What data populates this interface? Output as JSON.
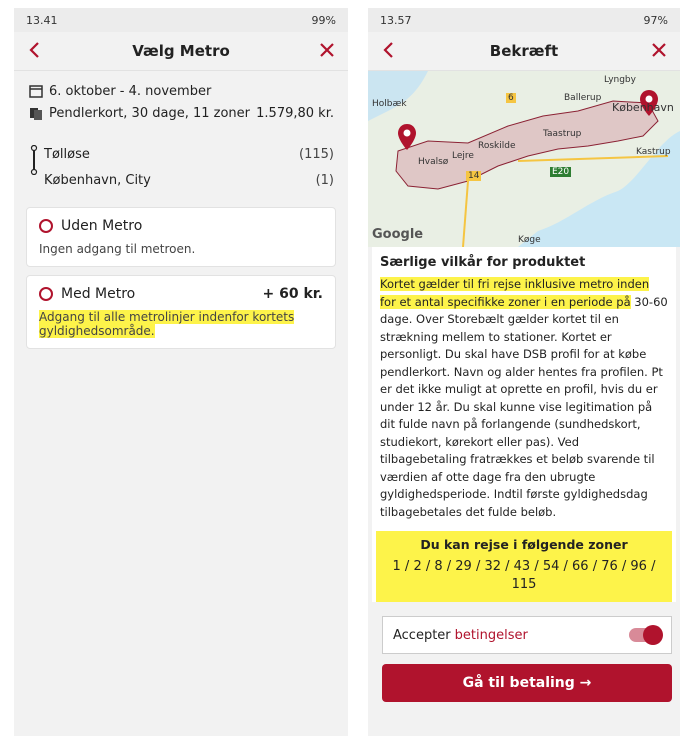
{
  "left": {
    "status": {
      "time": "13.41",
      "battery": "99%"
    },
    "title": "Vælg Metro",
    "trip": {
      "dates": "6. oktober - 4. november",
      "ticket": "Pendlerkort, 30 dage, 11 zoner",
      "price": "1.579,80 kr."
    },
    "stops": [
      {
        "name": "Tølløse",
        "zone": "(115)"
      },
      {
        "name": "København, City",
        "zone": "(1)"
      }
    ],
    "options": [
      {
        "title": "Uden Metro",
        "addon": "",
        "desc": "Ingen adgang til metroen."
      },
      {
        "title": "Med Metro",
        "addon": "+ 60 kr.",
        "desc": "Adgang til alle metrolinjer indenfor kortets gyldighedsområde."
      }
    ]
  },
  "right": {
    "status": {
      "time": "13.57",
      "battery": "97%"
    },
    "title": "Bekræft",
    "map": {
      "labels": [
        "Lyngby",
        "Holbæk",
        "Ballerup",
        "København",
        "Roskilde",
        "Taastrup",
        "Kastrup",
        "Hvalsø",
        "Lejre",
        "Køge",
        "E20",
        "14",
        "6",
        "Google"
      ]
    },
    "terms": {
      "heading": "Særlige vilkår for produktet",
      "text_highlight": "Kortet gælder til fri rejse inklusive metro inden for et antal specifikke zoner i en periode på",
      "text_rest": "30-60 dage. Over Storebælt gælder kortet til en strækning mellem to stationer. Kortet er personligt. Du skal have DSB profil for at købe pendlerkort. Navn og alder hentes fra profilen. Pt er det ikke muligt at oprette en profil, hvis du er under 12 år. Du skal kunne vise legitimation på dit fulde navn på forlangende (sundhedskort, studiekort, kørekort eller pas). Ved tilbagebetaling fratrækkes et beløb svarende til værdien af otte dage fra den ubrugte gyldighedsperiode. Indtil første gyldighedsdag tilbagebetales det fulde beløb.",
      "zones_title": "Du kan rejse i følgende zoner",
      "zones_list": "1 / 2 / 8 / 29 / 32 / 43 / 54 / 66 / 76 / 96 / 115"
    },
    "accept": {
      "prefix": "Accepter ",
      "link": "betingelser"
    },
    "pay_label": "Gå til betaling →"
  },
  "colors": {
    "brand_red": "#b0132d",
    "highlight": "#fdf34a"
  }
}
